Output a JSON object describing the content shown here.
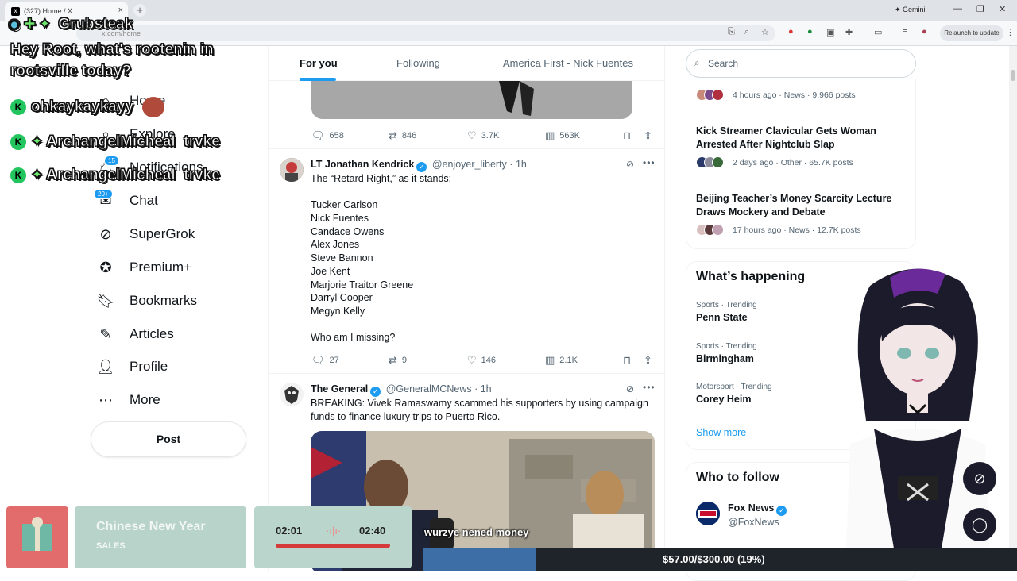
{
  "browser": {
    "tab_title": "(327) Home / X",
    "tab_favicon": "X",
    "gemini_label": "Gemini",
    "url": "x.com/home",
    "relaunch_label": "Relaunch to update"
  },
  "overlay_chat": {
    "streamer_tag": "Grubsteak",
    "prompt_line1": "Hey Root, what's rootenin in",
    "prompt_line2": "rootsville today?",
    "messages": [
      {
        "user": "ohkaykaykayy",
        "text": ""
      },
      {
        "user": "ArchangelMicheal",
        "text": "trvke"
      },
      {
        "user": "ArchangelMicheal",
        "text": "trvke"
      }
    ]
  },
  "nav": {
    "items": [
      {
        "label": "Home",
        "icon": "home-icon"
      },
      {
        "label": "Explore",
        "icon": "search-icon"
      },
      {
        "label": "Notifications",
        "icon": "bell-icon",
        "badge": "15"
      },
      {
        "label": "Chat",
        "icon": "mail-icon",
        "badge": "20+"
      },
      {
        "label": "SuperGrok",
        "icon": "grok-icon"
      },
      {
        "label": "Premium+",
        "icon": "premium-icon"
      },
      {
        "label": "Bookmarks",
        "icon": "bookmark-icon"
      },
      {
        "label": "Articles",
        "icon": "articles-icon"
      },
      {
        "label": "Profile",
        "icon": "profile-icon"
      },
      {
        "label": "More",
        "icon": "more-icon"
      }
    ],
    "post_label": "Post"
  },
  "feed": {
    "tabs": [
      "For you",
      "Following",
      "America First - Nick Fuentes"
    ],
    "active_tab": "For you",
    "tweet0_stats": {
      "replies": "658",
      "reposts": "846",
      "likes": "3.7K",
      "views": "563K"
    },
    "tweet1": {
      "name": "LT Jonathan Kendrick",
      "handle": "@enjoyer_liberty",
      "time": "1h",
      "intro": "The “Retard Right,” as it stands:",
      "list": [
        "Tucker Carlson",
        "Nick Fuentes",
        "Candace Owens",
        "Alex Jones",
        "Steve Bannon",
        "Joe Kent",
        "Marjorie Traitor Greene",
        "Darryl Cooper",
        "Megyn Kelly"
      ],
      "closing": "Who am I missing?",
      "stats": {
        "replies": "27",
        "reposts": "9",
        "likes": "146",
        "views": "2.1K"
      }
    },
    "tweet2": {
      "name": "The General",
      "handle": "@GeneralMCNews",
      "time": "1h",
      "line1": "BREAKING: Vivek Ramaswamy scammed his supporters by using campaign",
      "line2": "funds to finance luxury trips to Puerto Rico."
    }
  },
  "sidebar": {
    "search_placeholder": "Search",
    "trends_top": [
      {
        "title": "",
        "meta": "4 hours ago · News · 9,966 posts"
      },
      {
        "title": "Kick Streamer Clavicular Gets Woman Arrested After Nightclub Slap",
        "meta": "2 days ago · Other · 65.7K posts"
      },
      {
        "title": "Beijing Teacher’s Money Scarcity Lecture Draws Mockery and Debate",
        "meta": "17 hours ago · News · 12.7K posts"
      }
    ],
    "happening_title": "What’s happening",
    "happening": [
      {
        "meta": "Sports · Trending",
        "name": "Penn State"
      },
      {
        "meta": "Sports · Trending",
        "name": "Birmingham"
      },
      {
        "meta": "Motorsport · Trending",
        "name": "Corey Heim"
      }
    ],
    "show_more": "Show more",
    "who_to_follow_title": "Who to follow",
    "follow": [
      {
        "name": "Fox News",
        "handle": "@FoxNews"
      }
    ]
  },
  "stream": {
    "event_title": "Chinese New Year",
    "event_sub": "SALES",
    "player_elapsed": "02:01",
    "player_total": "02:40",
    "subtitle": "wurzye nened money",
    "goal": "$57.00/$300.00 (19%)",
    "goal_progress": 0.19
  },
  "colors": {
    "accent": "#1d9bf0",
    "text": "#0f1419",
    "muted": "#536471"
  }
}
